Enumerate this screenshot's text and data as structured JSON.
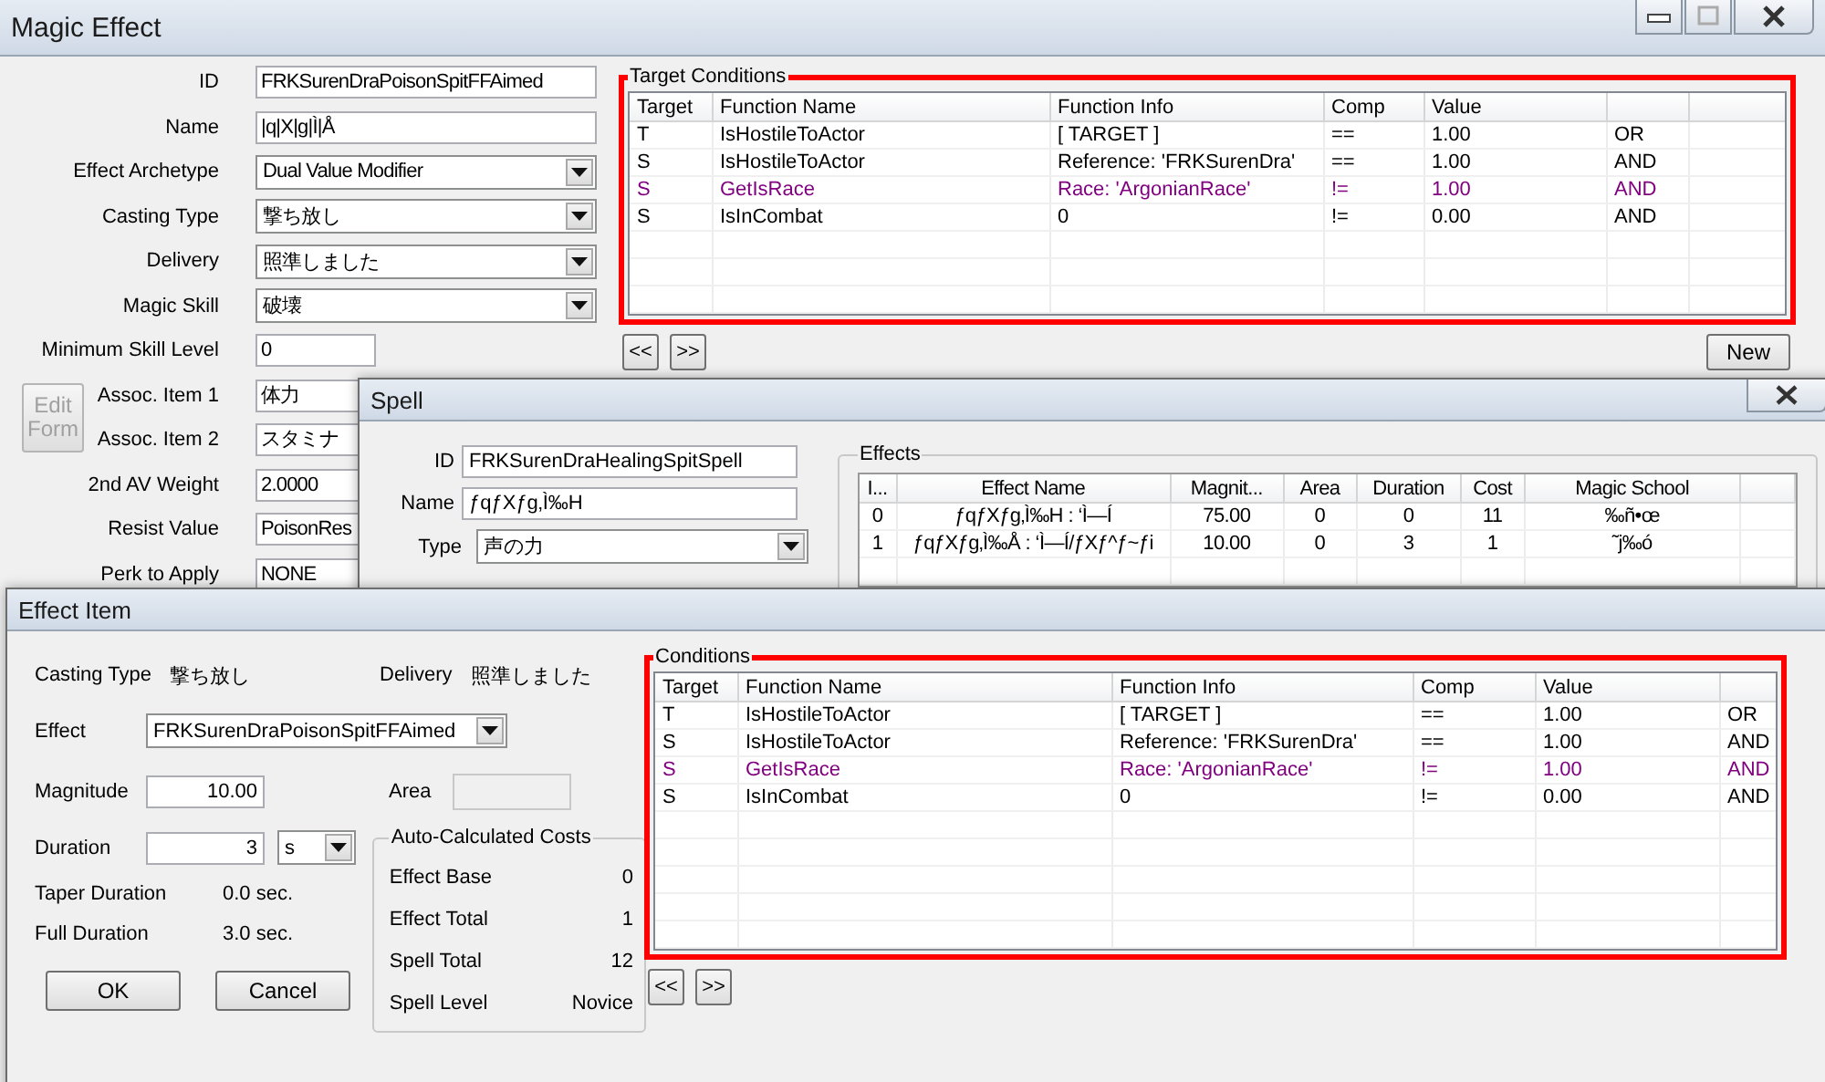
{
  "magic_effect": {
    "title": "Magic Effect",
    "fields": [
      {
        "label": "ID",
        "kind": "text",
        "value": "FRKSurenDraPoisonSpitFFAimed"
      },
      {
        "label": "Name",
        "kind": "text",
        "value": "|q|X|g|Ì|Å"
      },
      {
        "label": "Effect Archetype",
        "kind": "dropdown",
        "value": "Dual Value Modifier"
      },
      {
        "label": "Casting Type",
        "kind": "dropdown",
        "value": "撃ち放し"
      },
      {
        "label": "Delivery",
        "kind": "dropdown",
        "value": "照準しました"
      },
      {
        "label": "Magic Skill",
        "kind": "dropdown",
        "value": "破壊"
      },
      {
        "label": "Minimum Skill Level",
        "kind": "short",
        "value": "0"
      },
      {
        "label": "Assoc. Item 1",
        "kind": "text",
        "value": "体力"
      },
      {
        "label": "Assoc. Item 2",
        "kind": "text",
        "value": "スタミナ"
      },
      {
        "label": "2nd AV Weight",
        "kind": "text",
        "value": "2.0000"
      },
      {
        "label": "Resist Value",
        "kind": "text",
        "value": "PoisonRes"
      },
      {
        "label": "Perk to Apply",
        "kind": "text",
        "value": "NONE"
      }
    ],
    "edit_form_button": {
      "label": "Edit Form",
      "disabled": true
    },
    "target_conditions": {
      "title": "Target Conditions",
      "columns": [
        "Target",
        "Function Name",
        "Function Info",
        "Comp",
        "Value"
      ],
      "rows": [
        {
          "cells": [
            "T",
            "IsHostileToActor",
            "[ TARGET ]",
            "==",
            "1.00",
            "OR"
          ],
          "highlighted": false
        },
        {
          "cells": [
            "S",
            "IsHostileToActor",
            "Reference: 'FRKSurenDra'",
            "==",
            "1.00",
            "AND"
          ],
          "highlighted": false
        },
        {
          "cells": [
            "S",
            "GetIsRace",
            "Race: 'ArgonianRace'",
            "!=",
            "1.00",
            "AND"
          ],
          "highlighted": true
        },
        {
          "cells": [
            "S",
            "IsInCombat",
            "0",
            "!=",
            "0.00",
            "AND"
          ],
          "highlighted": false
        }
      ]
    },
    "nav_buttons": [
      "<<",
      ">>"
    ],
    "new_button": "New"
  },
  "spell": {
    "title": "Spell",
    "fields": [
      {
        "label": "ID",
        "kind": "text",
        "value": "FRKSurenDraHealingSpitSpell"
      },
      {
        "label": "Name",
        "kind": "text",
        "value": "ƒqƒXƒg‚Ì‰H"
      },
      {
        "label": "Type",
        "kind": "dropdown",
        "value": "声の力"
      }
    ],
    "effects": {
      "title": "Effects",
      "columns": [
        "I...",
        "Effect Name",
        "Magnit...",
        "Area",
        "Duration",
        "Cost",
        "Magic School"
      ],
      "rows": [
        {
          "cells": [
            "0",
            "ƒqƒXƒg‚Ì‰H : ‘Ì—Í",
            "75.00",
            "0",
            "0",
            "11",
            "‰ñ•œ"
          ]
        },
        {
          "cells": [
            "1",
            "ƒqƒXƒg‚Ì‰Å : ‘Ì—Í/ƒXƒ^ƒ~ƒi",
            "10.00",
            "0",
            "3",
            "1",
            "˜j‰ó"
          ]
        }
      ]
    }
  },
  "effect_item": {
    "title": "Effect Item",
    "casting_type": {
      "label": "Casting Type",
      "value": "撃ち放し"
    },
    "delivery": {
      "label": "Delivery",
      "value": "照準しました"
    },
    "effect": {
      "label": "Effect",
      "value": "FRKSurenDraPoisonSpitFFAimed"
    },
    "magnitude": {
      "label": "Magnitude",
      "value": "10.00"
    },
    "area": {
      "label": "Area",
      "disabled": true
    },
    "duration": {
      "label": "Duration",
      "value": "3",
      "unit": "s"
    },
    "taper_duration": {
      "label": "Taper Duration",
      "value": "0.0 sec."
    },
    "full_duration": {
      "label": "Full Duration",
      "value": "3.0 sec."
    },
    "costs": {
      "title": "Auto-Calculated Costs",
      "items": [
        {
          "label": "Effect Base",
          "value": "0"
        },
        {
          "label": "Effect Total",
          "value": "1"
        },
        {
          "label": "Spell Total",
          "value": "12"
        },
        {
          "label": "Spell Level",
          "value": "Novice"
        }
      ]
    },
    "ok_button": "OK",
    "cancel_button": "Cancel",
    "conditions": {
      "title": "Conditions",
      "columns": [
        "Target",
        "Function Name",
        "Function Info",
        "Comp",
        "Value"
      ],
      "rows": [
        {
          "cells": [
            "T",
            "IsHostileToActor",
            "[ TARGET ]",
            "==",
            "1.00",
            "OR"
          ],
          "highlighted": false
        },
        {
          "cells": [
            "S",
            "IsHostileToActor",
            "Reference: 'FRKSurenDra'",
            "==",
            "1.00",
            "AND"
          ],
          "highlighted": false
        },
        {
          "cells": [
            "S",
            "GetIsRace",
            "Race: 'ArgonianRace'",
            "!=",
            "1.00",
            "AND"
          ],
          "highlighted": true
        },
        {
          "cells": [
            "S",
            "IsInCombat",
            "0",
            "!=",
            "0.00",
            "AND"
          ],
          "highlighted": false
        }
      ]
    },
    "nav_buttons": [
      "<<",
      ">>"
    ]
  }
}
